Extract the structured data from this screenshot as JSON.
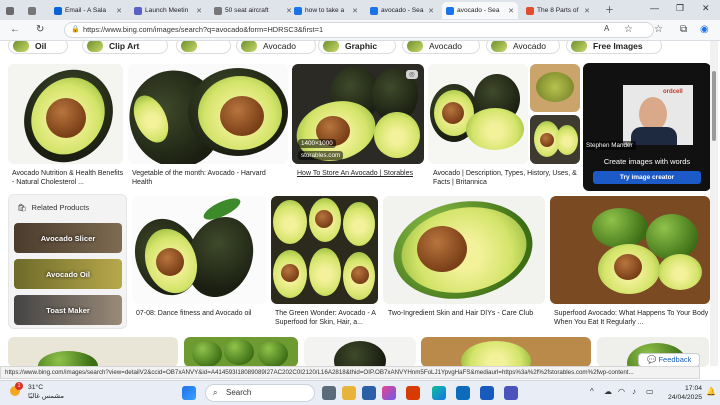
{
  "tabs": [
    {
      "label": "",
      "color": "#6b6b6b"
    },
    {
      "label": "",
      "color": "#6b6b6b"
    },
    {
      "label": "Email - A Sala",
      "color": "#0a64d6"
    },
    {
      "label": "Launch Meetin",
      "color": "#5b5fc7"
    },
    {
      "label": "50 seat aircraft",
      "color": "#777"
    },
    {
      "label": "how to take a",
      "color": "#1a73e8"
    },
    {
      "label": "avocado - Sea",
      "color": "#1a73e8"
    },
    {
      "label": "avocado - Sea",
      "color": "#1a73e8",
      "active": true
    },
    {
      "label": "The 8 Parts of",
      "color": "#e34d2d"
    }
  ],
  "address": {
    "url": "https://www.bing.com/images/search?q=avocado&form=HDRSC3&first=1"
  },
  "pills": [
    {
      "label": "Oil"
    },
    {
      "label": "Clip Art"
    },
    {
      "label": ""
    },
    {
      "label": "Avocado"
    },
    {
      "label": "Graphic"
    },
    {
      "label": "Avocado"
    },
    {
      "label": "Avocado"
    },
    {
      "label": "Free Images"
    }
  ],
  "results_row1": [
    {
      "caption": "Avocado Nutrition & Health Benefits - Natural Cholesterol ..."
    },
    {
      "caption": "Vegetable of the month: Avocado - Harvard Health"
    },
    {
      "caption": "How To Store An Avocado | Storables",
      "size": "1400×1000",
      "source": "storables.com"
    },
    {
      "caption": "Avocado | Description, Types, History, Uses, & Facts | Britannica"
    }
  ],
  "creator": {
    "title": "Create images with words",
    "button": "Try image creator",
    "presenter": "Stephen Mander",
    "brand": "ordcell"
  },
  "related": {
    "heading": "Related Products",
    "items": [
      "Avocado Slicer",
      "Avocado Oil",
      "Toast Maker"
    ]
  },
  "results_row2": [
    {
      "caption": "07-08: Dance fitness and Avocado oil"
    },
    {
      "caption": "The Green Wonder: Avocado - A Superfood for Skin, Hair, a..."
    },
    {
      "caption": "Two-Ingredient Skin and Hair DIYs - Care Club"
    },
    {
      "caption": "Superfood Avocado: What Happens To Your Body When You Eat It Regularly ..."
    }
  ],
  "feedback": "Feedback",
  "status_url": "https://www.bing.com/images/search?view=detailV2&ccid=OB7xANVY&id=A414593I18089089I27AC202C0I2120/L16A2818&thid=OIP.OB7xANVYHnm5FoLJ1YpvgHaFS&mediaurl=https%3a%2f%2fstorables.com%2fwp-content...",
  "taskbar": {
    "weather_temp": "31°C",
    "weather_desc": "مشمس غالبًا",
    "search": "Search",
    "time": "17:04",
    "date": "24/04/2025",
    "notif_count": "1"
  }
}
